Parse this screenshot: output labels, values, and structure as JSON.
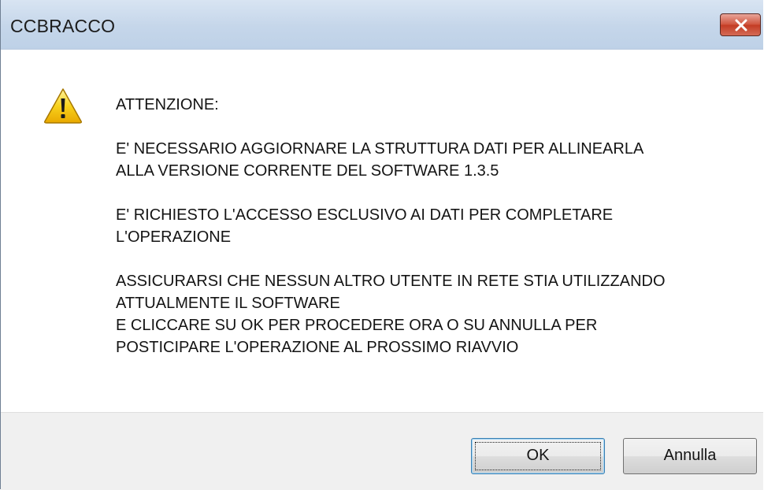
{
  "window": {
    "title": "CCBRACCO"
  },
  "icons": {
    "close": "close-icon",
    "warning": "warning-icon"
  },
  "message": {
    "heading": "ATTENZIONE:",
    "lines": [
      "E' NECESSARIO AGGIORNARE LA STRUTTURA DATI PER ALLINEARLA",
      "ALLA VERSIONE CORRENTE DEL SOFTWARE 1.3.5",
      "E' RICHIESTO L'ACCESSO ESCLUSIVO AI DATI PER COMPLETARE",
      "L'OPERAZIONE",
      "ASSICURARSI CHE NESSUN ALTRO UTENTE IN RETE STIA UTILIZZANDO",
      "ATTUALMENTE IL SOFTWARE",
      "E CLICCARE SU OK PER PROCEDERE ORA O SU ANNULLA PER",
      "POSTICIPARE L'OPERAZIONE AL PROSSIMO RIAVVIO"
    ]
  },
  "buttons": {
    "ok_label": "OK",
    "cancel_label": "Annulla"
  },
  "colors": {
    "close_button": "#c84a33",
    "titlebar": "#c5d6ea",
    "footer": "#f0f0f0",
    "warning_yellow": "#f5c400"
  }
}
